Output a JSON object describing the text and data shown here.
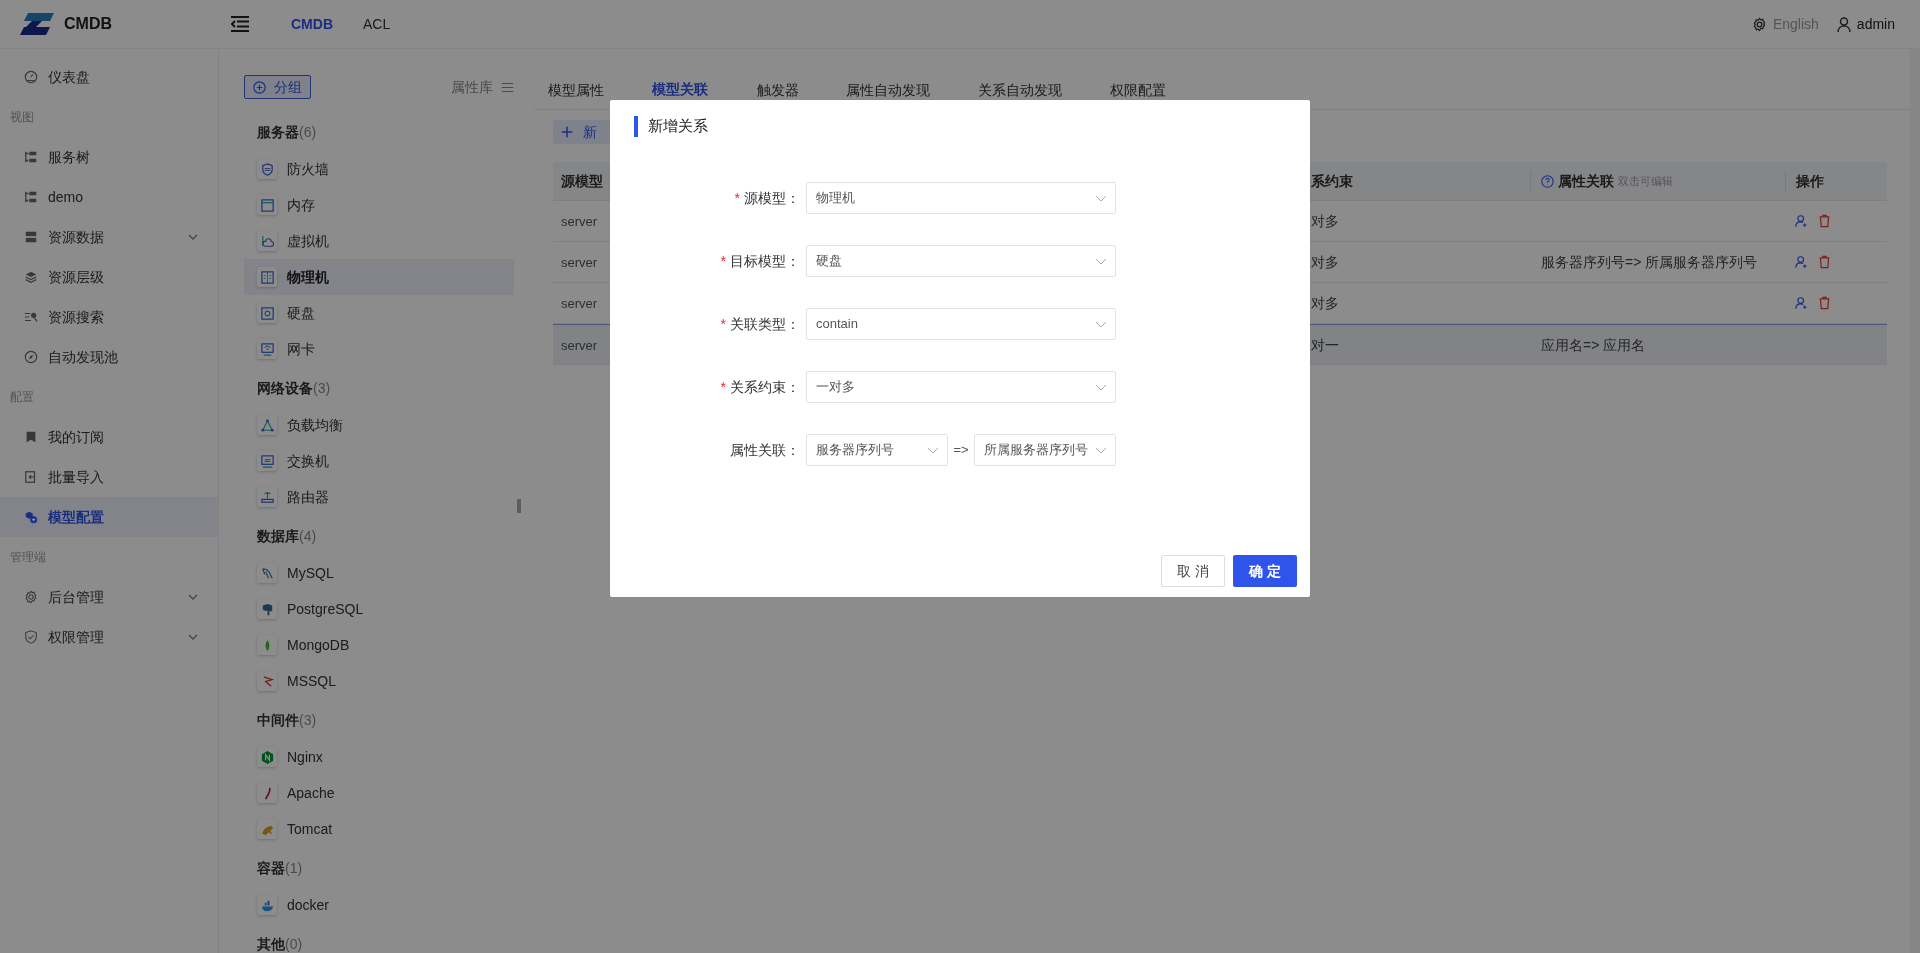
{
  "header": {
    "logo_text": "CMDB",
    "nav": [
      {
        "label": "CMDB",
        "selected": true
      },
      {
        "label": "ACL",
        "selected": false
      }
    ],
    "language": "English",
    "user": "admin"
  },
  "sidebar": {
    "items": [
      {
        "kind": "item",
        "label": "仪表盘",
        "selected": false,
        "expandable": false
      },
      {
        "kind": "section",
        "label": "视图"
      },
      {
        "kind": "item",
        "label": "服务树",
        "selected": false,
        "expandable": false
      },
      {
        "kind": "item",
        "label": "demo",
        "selected": false,
        "expandable": false
      },
      {
        "kind": "item",
        "label": "资源数据",
        "selected": false,
        "expandable": true
      },
      {
        "kind": "item",
        "label": "资源层级",
        "selected": false,
        "expandable": false
      },
      {
        "kind": "item",
        "label": "资源搜索",
        "selected": false,
        "expandable": false
      },
      {
        "kind": "item",
        "label": "自动发现池",
        "selected": false,
        "expandable": false
      },
      {
        "kind": "section",
        "label": "配置"
      },
      {
        "kind": "item",
        "label": "我的订阅",
        "selected": false,
        "expandable": false
      },
      {
        "kind": "item",
        "label": "批量导入",
        "selected": false,
        "expandable": false
      },
      {
        "kind": "item",
        "label": "模型配置",
        "selected": true,
        "expandable": false
      },
      {
        "kind": "section",
        "label": "管理端"
      },
      {
        "kind": "item",
        "label": "后台管理",
        "selected": false,
        "expandable": true
      },
      {
        "kind": "item",
        "label": "权限管理",
        "selected": false,
        "expandable": true
      }
    ]
  },
  "models_panel": {
    "add_group": "分组",
    "library": "属性库",
    "groups": [
      {
        "name": "服务器",
        "count": "(6)",
        "models": [
          {
            "name": "防火墙",
            "selected": false
          },
          {
            "name": "内存",
            "selected": false
          },
          {
            "name": "虚拟机",
            "selected": false
          },
          {
            "name": "物理机",
            "selected": true
          },
          {
            "name": "硬盘",
            "selected": false
          },
          {
            "name": "网卡",
            "selected": false
          }
        ]
      },
      {
        "name": "网络设备",
        "count": "(3)",
        "models": [
          {
            "name": "负载均衡",
            "selected": false
          },
          {
            "name": "交换机",
            "selected": false
          },
          {
            "name": "路由器",
            "selected": false
          }
        ]
      },
      {
        "name": "数据库",
        "count": "(4)",
        "models": [
          {
            "name": "MySQL",
            "selected": false
          },
          {
            "name": "PostgreSQL",
            "selected": false
          },
          {
            "name": "MongoDB",
            "selected": false
          },
          {
            "name": "MSSQL",
            "selected": false
          }
        ]
      },
      {
        "name": "中间件",
        "count": "(3)",
        "models": [
          {
            "name": "Nginx",
            "selected": false
          },
          {
            "name": "Apache",
            "selected": false
          },
          {
            "name": "Tomcat",
            "selected": false
          }
        ]
      },
      {
        "name": "容器",
        "count": "(1)",
        "models": [
          {
            "name": "docker",
            "selected": false
          }
        ]
      },
      {
        "name": "其他",
        "count": "(0)"
      }
    ]
  },
  "tabs": [
    {
      "label": "模型属性",
      "selected": false
    },
    {
      "label": "模型关联",
      "selected": true
    },
    {
      "label": "触发器",
      "selected": false
    },
    {
      "label": "属性自动发现",
      "selected": false
    },
    {
      "label": "关系自动发现",
      "selected": false
    },
    {
      "label": "权限配置",
      "selected": false
    }
  ],
  "add_button": "新",
  "table": {
    "columns": [
      {
        "label": "源模型"
      },
      {
        "label": "系约束"
      },
      {
        "label": "属性关联",
        "hint": "双击可编辑"
      },
      {
        "label": "操作"
      }
    ],
    "rows": [
      {
        "source": "server",
        "constraint": "对多",
        "actions": true,
        "highlighted": false
      },
      {
        "source": "server",
        "constraint": "对多",
        "attr": "服务器序列号=> 所属服务器序列号",
        "actions": true,
        "highlighted": false
      },
      {
        "source": "server",
        "constraint": "对多",
        "actions": true,
        "highlighted": false
      },
      {
        "source": "server",
        "constraint": "对一",
        "attr": "应用名=> 应用名",
        "actions": false,
        "highlighted": true
      }
    ]
  },
  "dialog": {
    "title": "新增关系",
    "fields": [
      {
        "kind": "select",
        "label": "源模型：",
        "required": true,
        "value": "物理机"
      },
      {
        "kind": "select",
        "label": "目标模型：",
        "required": true,
        "value": "硬盘"
      },
      {
        "kind": "select",
        "label": "关联类型：",
        "required": true,
        "value": "contain"
      },
      {
        "kind": "select",
        "label": "关系约束：",
        "required": true,
        "value": "一对多"
      },
      {
        "kind": "pair",
        "label": "属性关联：",
        "required": false,
        "values": [
          "服务器序列号",
          "所属服务器序列号"
        ],
        "separator": "=>"
      }
    ],
    "required_mark": "*",
    "cancel": "取 消",
    "ok": "确 定"
  }
}
